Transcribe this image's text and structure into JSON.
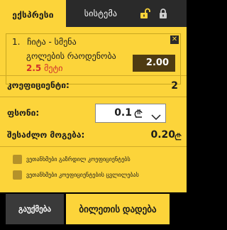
{
  "tabs": {
    "express": "ექსპრესი",
    "system": "სისტემა"
  },
  "bet": {
    "index": "1.",
    "teams": "ჩიტა - სმენა",
    "market": "გოლების რაოდენობა",
    "selection_value": "2.5",
    "selection_unit": "მეტი",
    "odds": "2.00"
  },
  "coefficient": {
    "label": "კოეფიციენტი:",
    "value": "2"
  },
  "stake": {
    "label": "ფსონი:",
    "value": "0.1"
  },
  "possible_win": {
    "label": "შესაძლო მოგება:",
    "value": "0.20"
  },
  "options": {
    "accept_higher": "ვეთანხმები გაზრდილ კოეფიციენტებს",
    "accept_changes": "ვეთანხმები კოეფიციენტების ცვლილებას"
  },
  "buttons": {
    "clear": "გაუქმება",
    "place": "ბილეთის დადება"
  },
  "colors": {
    "accent": "#fcd43a",
    "odds_bg": "#4e3b12",
    "selection_red": "#d0312d"
  },
  "icons": {
    "unlock": "unlock-icon",
    "lock": "lock-icon",
    "close": "close-icon",
    "currency": "lari-icon",
    "dropdown": "chevron-down-icon"
  }
}
